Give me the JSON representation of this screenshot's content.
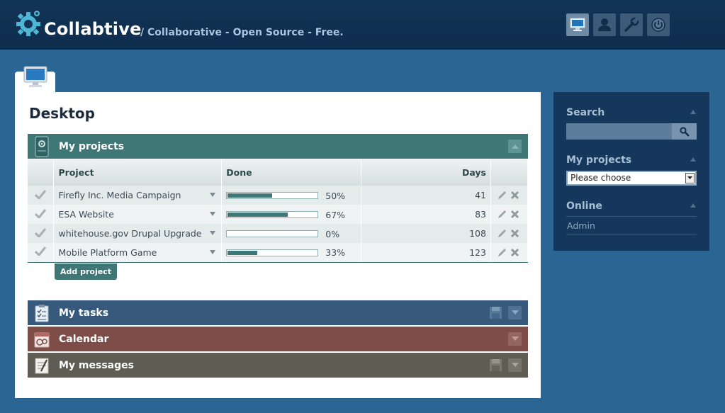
{
  "header": {
    "brand": "Collabtive",
    "tagline": "/ Collaborative - Open Source - Free.",
    "nav": [
      "desktop-icon",
      "user-icon",
      "wrench-icon",
      "power-icon"
    ]
  },
  "main": {
    "title": "Desktop",
    "projects_section": {
      "title": "My projects",
      "columns": [
        "Project",
        "Done",
        "Days"
      ],
      "rows": [
        {
          "name": "Firefly Inc. Media Campaign",
          "done_pct": 50,
          "done_label": "50%",
          "days": "41"
        },
        {
          "name": "ESA Website",
          "done_pct": 67,
          "done_label": "67%",
          "days": "83"
        },
        {
          "name": "whitehouse.gov Drupal Upgrade",
          "done_pct": 0,
          "done_label": "0%",
          "days": "108"
        },
        {
          "name": "Mobile Platform Game",
          "done_pct": 33,
          "done_label": "33%",
          "days": "123"
        }
      ],
      "add_button": "Add project"
    },
    "tasks_section": {
      "title": "My tasks"
    },
    "calendar_section": {
      "title": "Calendar"
    },
    "messages_section": {
      "title": "My messages"
    }
  },
  "sidebar": {
    "search": {
      "heading": "Search",
      "value": ""
    },
    "projects": {
      "heading": "My projects",
      "selected": "Please choose"
    },
    "online": {
      "heading": "Online",
      "users": [
        "Admin"
      ]
    }
  },
  "colors": {
    "background": "#2b6593",
    "header": "#123457",
    "projects_bar": "#3f7777",
    "tasks_bar": "#36597c",
    "calendar_bar": "#7f4d47",
    "messages_bar": "#5e5c53"
  }
}
